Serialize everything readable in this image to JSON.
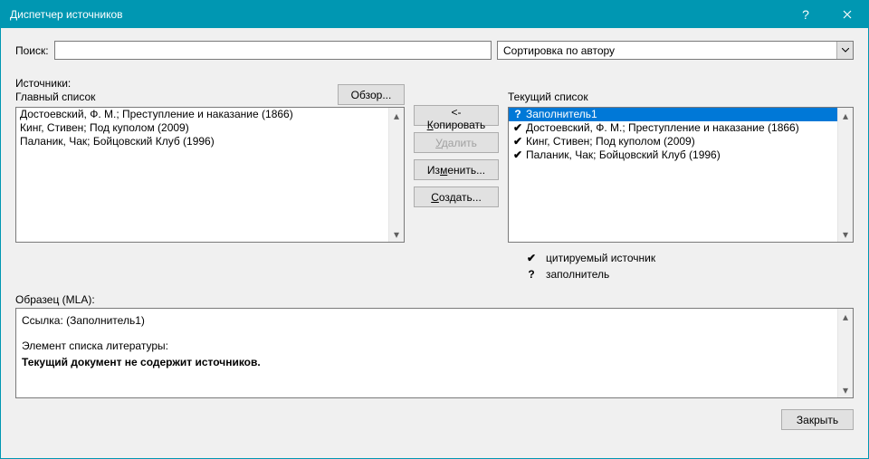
{
  "title": "Диспетчер источников",
  "search": {
    "label": "Поиск:",
    "value": ""
  },
  "sort": {
    "value": "Сортировка по автору"
  },
  "sources_label": "Источники:",
  "master_list_label": "Главный список",
  "current_list_label": "Текущий список",
  "browse_label": "Обзор...",
  "buttons": {
    "copy": "<- Копировать",
    "copy_access": "К",
    "delete": "Удалить",
    "delete_access": "У",
    "edit": "Изменить...",
    "edit_access": "м",
    "create": "Создать...",
    "create_access": "С"
  },
  "master_list": [
    "Достоевский, Ф. М.; Преступление и наказание (1866)",
    "Кинг, Стивен; Под куполом (2009)",
    "Паланик, Чак; Бойцовский Клуб (1996)"
  ],
  "current_list": [
    {
      "mark": "?",
      "text": "Заполнитель1",
      "selected": true
    },
    {
      "mark": "✔",
      "text": "Достоевский, Ф. М.; Преступление и наказание (1866)"
    },
    {
      "mark": "✔",
      "text": "Кинг, Стивен; Под куполом (2009)"
    },
    {
      "mark": "✔",
      "text": "Паланик, Чак; Бойцовский Клуб (1996)"
    }
  ],
  "legend": {
    "cited": "цитируемый источник",
    "placeholder": "заполнитель"
  },
  "preview_label": "Образец (MLA):",
  "preview": {
    "line1": "Ссылка:  (Заполнитель1)",
    "line2": "Элемент списка литературы:",
    "line3": "Текущий документ не содержит источников."
  },
  "close_label": "Закрыть"
}
